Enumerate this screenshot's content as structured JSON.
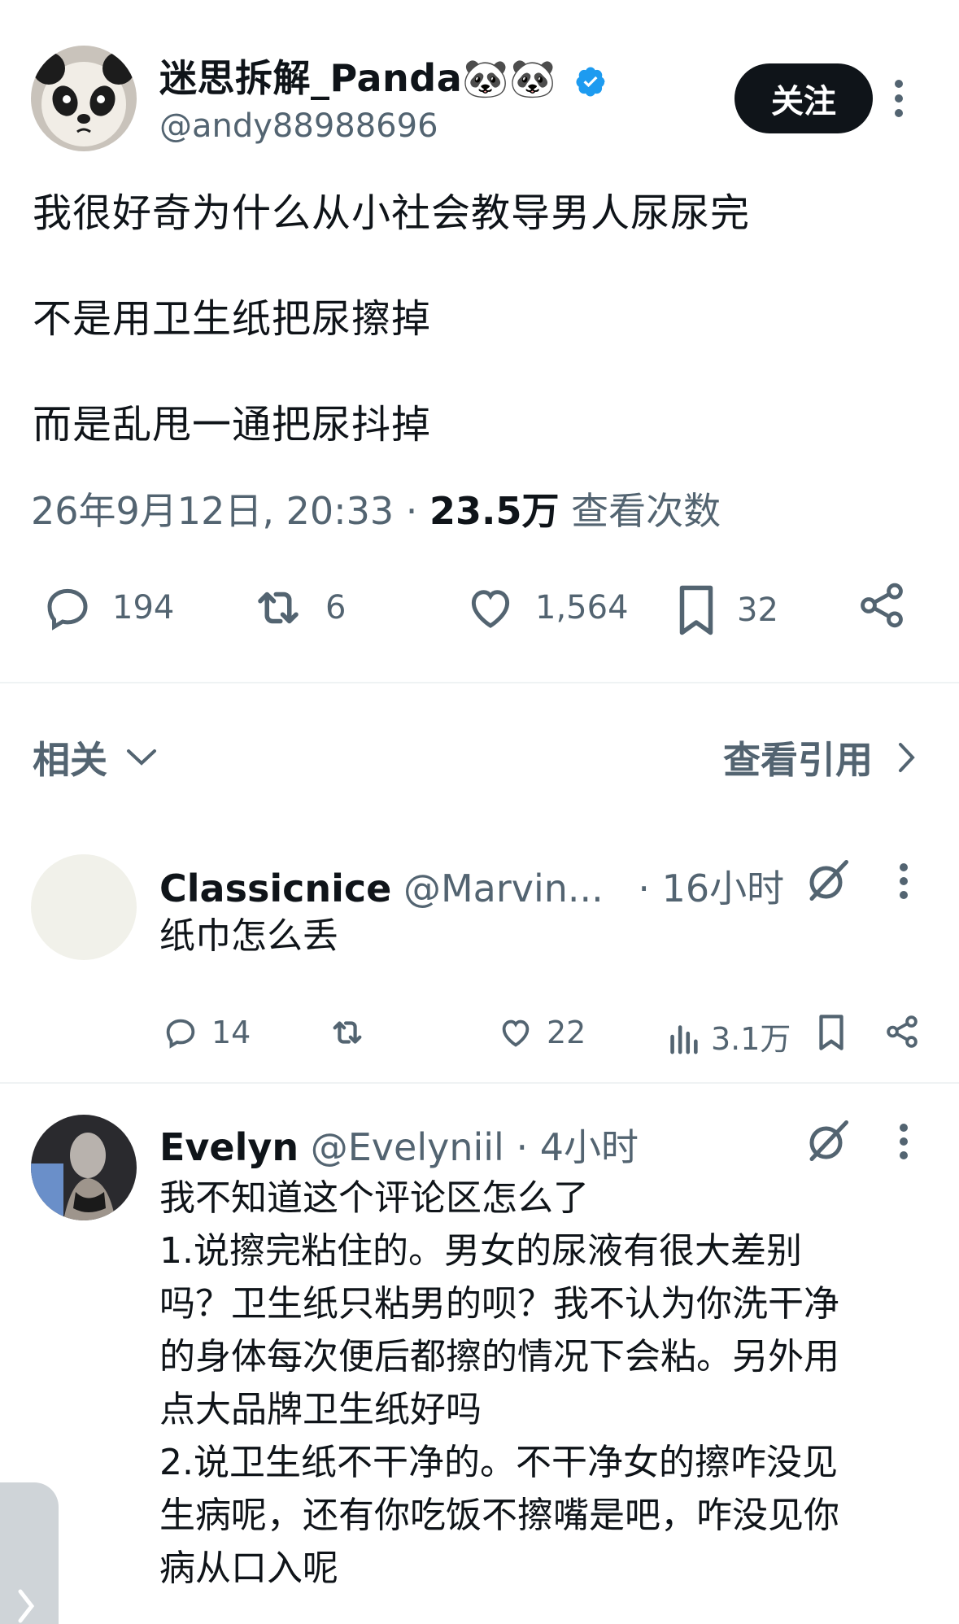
{
  "tweet": {
    "display_name": "迷思拆解_Panda",
    "name_emojis": "🐼🐼",
    "handle": "@andy88988696",
    "follow_label": "关注",
    "text_lines": [
      "我很好奇为什么从小社会教导男人尿尿完",
      "不是用卫生纸把尿擦掉",
      "而是乱甩一通把尿抖掉"
    ],
    "timestamp": "26年9月12日, 20:33",
    "separator": "·",
    "views_count": "23.5万",
    "views_label": "查看次数",
    "stats": {
      "replies": "194",
      "retweets": "6",
      "likes": "1,564",
      "bookmarks": "32"
    }
  },
  "related_bar": {
    "related_label": "相关",
    "quotes_label": "查看引用"
  },
  "replies": [
    {
      "display_name": "Classicnice",
      "handle": "@Marvin...",
      "time": "· 16小时",
      "text": "纸巾怎么丢",
      "stats": {
        "replies": "14",
        "retweets": "",
        "likes": "22",
        "views": "3.1万"
      }
    },
    {
      "display_name": "Evelyn",
      "handle": "@Evelyniil",
      "time": "· 4小时",
      "text_lines": [
        "我不知道这个评论区怎么了",
        "1.说擦完粘住的。男女的尿液有很大差别",
        "吗？卫生纸只粘男的呗？我不认为你洗干净",
        "的身体每次便后都擦的情况下会粘。另外用",
        "点大品牌卫生纸好吗",
        "2.说卫生纸不干净的。不干净女的擦咋没见",
        "生病呢，还有你吃饭不擦嘴是吧，咋没见你",
        "病从口入呢"
      ]
    }
  ],
  "colors": {
    "text_primary": "#0f1419",
    "text_secondary": "#536471",
    "verified": "#1d9bf0",
    "divider": "#eff3f4"
  }
}
